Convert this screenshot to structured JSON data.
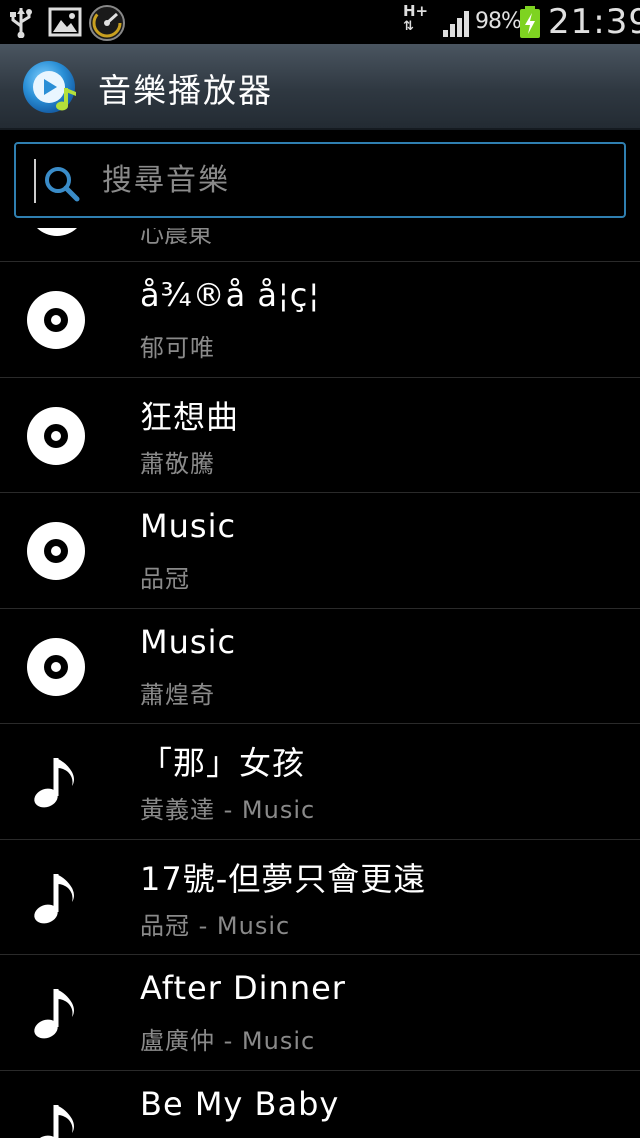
{
  "status_bar": {
    "network": "H+",
    "battery_percent": "98%",
    "time": "21:39"
  },
  "action_bar": {
    "title": "音樂播放器"
  },
  "search": {
    "placeholder": "搜尋音樂"
  },
  "list": {
    "partial_top": {
      "subtitle": "心晨東"
    },
    "items": [
      {
        "icon": "album-disc-icon",
        "title": "å¾®å å¦ç¦",
        "subtitle": "郁可唯"
      },
      {
        "icon": "album-disc-icon",
        "title": "狂想曲",
        "subtitle": "蕭敬騰"
      },
      {
        "icon": "album-disc-icon",
        "title": "Music",
        "subtitle": "品冠"
      },
      {
        "icon": "album-disc-icon",
        "title": "Music",
        "subtitle": "蕭煌奇"
      },
      {
        "icon": "music-note-icon",
        "title": "「那」女孩",
        "subtitle": "黃義達 - Music"
      },
      {
        "icon": "music-note-icon",
        "title": "17號-但夢只會更遠",
        "subtitle": "品冠 - Music"
      },
      {
        "icon": "music-note-icon",
        "title": "After Dinner",
        "subtitle": "盧廣仲 - Music"
      },
      {
        "icon": "music-note-icon",
        "title": "Be My Baby",
        "subtitle": ""
      }
    ]
  }
}
